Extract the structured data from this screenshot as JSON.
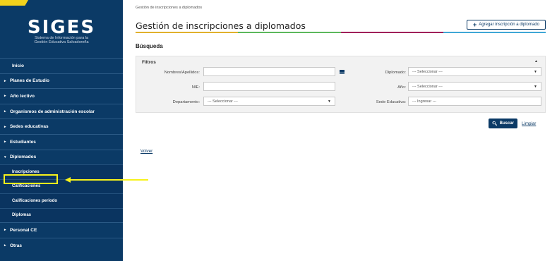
{
  "brand": {
    "title": "SIGES",
    "subtitle_line1": "Sistema de Información para la",
    "subtitle_line2": "Gestión Educativa Salvadoreña"
  },
  "sidebar": {
    "items": [
      {
        "label": "Inicio",
        "chevron": ""
      },
      {
        "label": "Planes de Estudio",
        "chevron": "▸"
      },
      {
        "label": "Año lectivo",
        "chevron": "▸"
      },
      {
        "label": "Organismos de administración escolar",
        "chevron": "▸"
      },
      {
        "label": "Sedes educativas",
        "chevron": "▸"
      },
      {
        "label": "Estudiantes",
        "chevron": "▸"
      },
      {
        "label": "Diplomados",
        "chevron": "▾"
      }
    ],
    "subitems": [
      "Inscripciones",
      "Calificaciones",
      "Calificaciones periodo",
      "Diplomas"
    ],
    "items_after": [
      {
        "label": "Personal CE",
        "chevron": "▸"
      },
      {
        "label": "Otras",
        "chevron": "▸"
      }
    ]
  },
  "breadcrumb": "Gestión de inscripciones a diplomados",
  "page_title": "Gestión de inscripciones a diplomados",
  "add_button": {
    "icon": "plus-icon",
    "label": "Agregar inscripción a diplomado"
  },
  "section_title": "Búsqueda",
  "filters": {
    "title": "Filtros",
    "collapse_icon": "▲",
    "nombres_label": "Nombres/Apellidos:",
    "nombres_value": "",
    "nie_label": "NIE:",
    "nie_value": "",
    "departamento_label": "Departamento:",
    "departamento_value": "--- Seleccionar ---",
    "diplomado_label": "Diplomado:",
    "diplomado_value": "--- Seleccionar ---",
    "anio_label": "Año:",
    "anio_value": "--- Seleccionar ---",
    "sede_label": "Sede Educativa:",
    "sede_placeholder": "--- Ingresar ---"
  },
  "search_button": {
    "icon": "search-icon",
    "label": "Buscar"
  },
  "clear_link": "Limpiar",
  "back_link": "Volver",
  "colors": {
    "primary": "#0b3a66",
    "bar": [
      "#e1b12c",
      "#5cb85c",
      "#a0205a",
      "#3fa7d6"
    ],
    "highlight": "#f7f21b"
  }
}
